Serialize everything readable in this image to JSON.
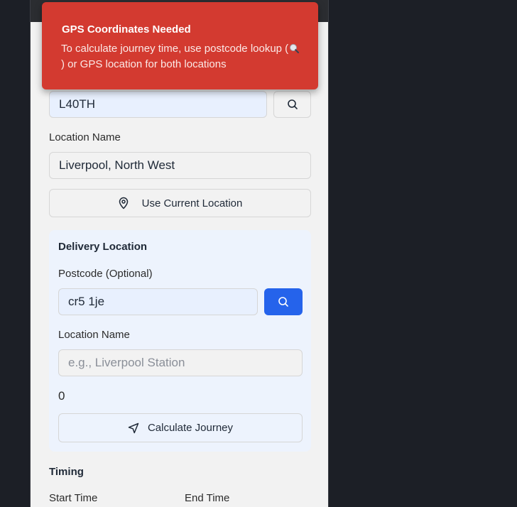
{
  "toast": {
    "title": "GPS Coordinates Needed",
    "body_part1": "To calculate journey time, use postcode lookup (",
    "body_part2": ") or GPS location for both locations"
  },
  "pickup": {
    "postcode_value": "L40TH",
    "location_name_label": "Location Name",
    "location_name_value": "Liverpool, North West",
    "use_current_location_label": "Use Current Location"
  },
  "delivery": {
    "title": "Delivery Location",
    "postcode_label": "Postcode (Optional)",
    "postcode_value": "cr5 1je",
    "location_name_label": "Location Name",
    "location_name_placeholder": "e.g., Liverpool Station",
    "counter": "0",
    "calculate_label": "Calculate Journey"
  },
  "timing": {
    "title": "Timing",
    "start_label": "Start Time",
    "end_label": "End Time"
  },
  "colors": {
    "toast": "#d33a30",
    "primary": "#2563eb",
    "input_blue": "#e8f0fe"
  }
}
